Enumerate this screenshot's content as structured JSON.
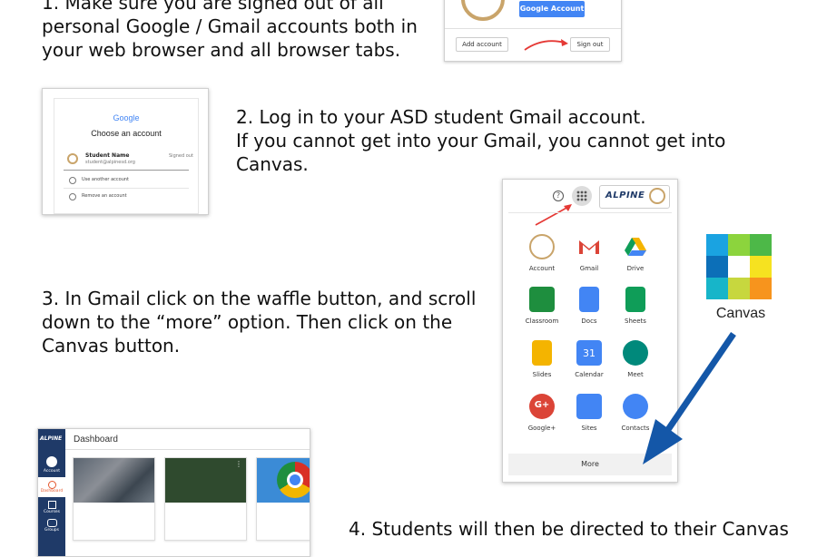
{
  "steps": {
    "s1": [
      "1. Make sure you are signed out of all",
      "personal Google / Gmail accounts both in",
      "your web browser and all browser tabs."
    ],
    "s2": [
      "2. Log in to your ASD student Gmail account.",
      "If you cannot get into your Gmail, you cannot get into",
      "Canvas."
    ],
    "s3": [
      "3. In Gmail click on the waffle button, and scroll",
      "down to the “more” option. Then click on the",
      "Canvas button."
    ],
    "s4": [
      "4. Students will then be directed to their Canvas"
    ]
  },
  "signout_panel": {
    "google_account_label": "Google Account",
    "add_account_label": "Add account",
    "sign_out_label": "Sign out"
  },
  "choose_account": {
    "google_logo": "Google",
    "title": "Choose an account",
    "student_name": "Student Name",
    "student_email": "student@alpinesd.org",
    "status": "Signed out",
    "use_another": "Use another account",
    "remove": "Remove an account"
  },
  "apps_menu": {
    "profile_badge": "ALPINE",
    "apps": [
      {
        "label": "Account",
        "icon": "account-icon"
      },
      {
        "label": "Gmail",
        "icon": "gmail-icon"
      },
      {
        "label": "Drive",
        "icon": "drive-icon"
      },
      {
        "label": "Classroom",
        "icon": "classroom-icon"
      },
      {
        "label": "Docs",
        "icon": "docs-icon"
      },
      {
        "label": "Sheets",
        "icon": "sheets-icon"
      },
      {
        "label": "Slides",
        "icon": "slides-icon"
      },
      {
        "label": "Calendar",
        "icon": "calendar-icon"
      },
      {
        "label": "Meet",
        "icon": "meet-icon"
      },
      {
        "label": "Google+",
        "icon": "google-plus-icon"
      },
      {
        "label": "Sites",
        "icon": "sites-icon"
      },
      {
        "label": "Contacts",
        "icon": "contacts-icon"
      }
    ],
    "calendar_day": "31",
    "gplus_glyph": "G+",
    "more_label": "More"
  },
  "canvas_logo": {
    "label": "Canvas"
  },
  "dashboard": {
    "logo": "ALPINE",
    "title": "Dashboard",
    "nav": [
      {
        "label": "Account"
      },
      {
        "label": "Dashboard"
      },
      {
        "label": "Courses"
      },
      {
        "label": "Groups"
      }
    ]
  },
  "colors": {
    "google_blue": "#4285f4",
    "arrow_red": "#e53935",
    "arrow_blue": "#1457a8",
    "canvas_sidebar": "#1f3a68"
  }
}
